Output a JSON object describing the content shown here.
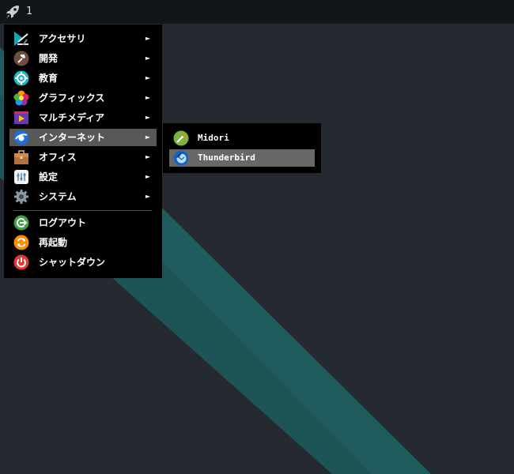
{
  "panel": {
    "launcher_icon": "rocket-icon",
    "workspace_label": "1"
  },
  "menu": {
    "items": [
      {
        "label": "アクセサリ",
        "icon": "accessories-icon",
        "has_submenu": true
      },
      {
        "label": "開発",
        "icon": "development-hammer-icon",
        "has_submenu": true
      },
      {
        "label": "教育",
        "icon": "education-icon",
        "has_submenu": true
      },
      {
        "label": "グラフィックス",
        "icon": "graphics-icon",
        "has_submenu": true
      },
      {
        "label": "マルチメディア",
        "icon": "multimedia-icon",
        "has_submenu": true
      },
      {
        "label": "インターネット",
        "icon": "internet-icon",
        "has_submenu": true,
        "highlighted": true
      },
      {
        "label": "オフィス",
        "icon": "office-briefcase-icon",
        "has_submenu": true
      },
      {
        "label": "設定",
        "icon": "settings-icon",
        "has_submenu": true
      },
      {
        "label": "システム",
        "icon": "system-gear-icon",
        "has_submenu": true
      }
    ],
    "session": [
      {
        "label": "ログアウト",
        "icon": "logout-icon"
      },
      {
        "label": "再起動",
        "icon": "restart-icon"
      },
      {
        "label": "シャットダウン",
        "icon": "shutdown-icon"
      }
    ],
    "submenu_arrow": "►"
  },
  "submenu": {
    "items": [
      {
        "label": "Midori",
        "icon": "midori-icon"
      },
      {
        "label": "Thunderbird",
        "icon": "thunderbird-icon",
        "highlighted": true
      }
    ]
  },
  "colors": {
    "menu_background": "#000000",
    "menu_highlight": "#585858",
    "submenu_highlight": "#686868",
    "panel_background": "#131618",
    "wallpaper_dark": "#242a2f",
    "wallpaper_stripe": "#1c5759"
  }
}
